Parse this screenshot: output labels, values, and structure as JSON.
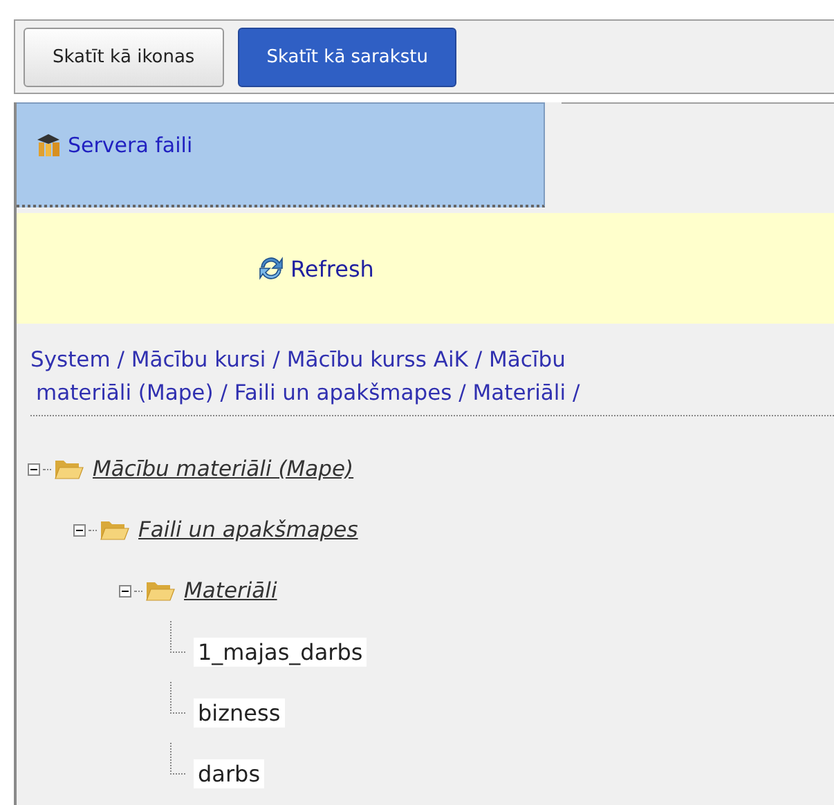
{
  "view_buttons": [
    {
      "label": "Skatīt kā ikonas",
      "selected": false
    },
    {
      "label": "Skatīt kā sarakstu",
      "selected": true
    }
  ],
  "panel": {
    "title": "Servera faili"
  },
  "refresh": {
    "label": "Refresh"
  },
  "breadcrumb": {
    "lines": [
      "System / Mācību kursi / Mācību kurss AiK / Mācību",
      "materiāli (Mape) / Faili un apakšmapes / Materiāli /"
    ]
  },
  "tree": [
    {
      "label": "Mācību materiāli (Mape)",
      "kind": "folder",
      "expanded": true,
      "children": [
        {
          "label": "Faili un apakšmapes",
          "kind": "folder",
          "expanded": true,
          "children": [
            {
              "label": "Materiāli",
              "kind": "folder",
              "expanded": true,
              "children": [
                {
                  "label": "1_majas_darbs",
                  "kind": "file"
                },
                {
                  "label": "bizness",
                  "kind": "file"
                },
                {
                  "label": "darbs",
                  "kind": "file"
                }
              ]
            }
          ]
        }
      ]
    }
  ]
}
